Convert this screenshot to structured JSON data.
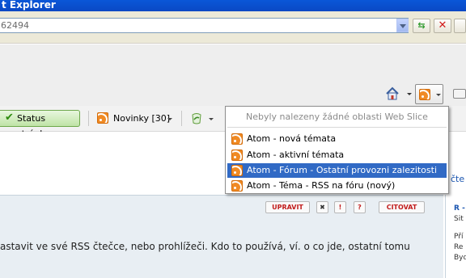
{
  "window": {
    "title": "t Explorer"
  },
  "address": {
    "value": "62494"
  },
  "toolbar": {
    "status_label": "Status stránky",
    "feeds_label": "Novinky [30]"
  },
  "feed_menu": {
    "note": "Nebyly nalezeny žádné oblasti Web Slice",
    "items": [
      {
        "label": "Atom - nová témata"
      },
      {
        "label": "Atom - aktivní témata"
      },
      {
        "label": "Atom - Fórum - Ostatní provozni zalezitosti",
        "highlighted": true
      },
      {
        "label": "Atom - Téma - RSS na fóru (nový)"
      }
    ]
  },
  "post": {
    "buttons": {
      "edit": "UPRAVIT",
      "delete": "✖",
      "report": "!",
      "help": "?",
      "quote": "CITOVAT"
    },
    "text": "astavit ve své RSS čtečce, nebo prohlížeči. Kdo to používá, ví. o co jde, ostatní tomu"
  },
  "sidebar": {
    "link": "čte",
    "author_prefix": "R -",
    "lines": [
      "Sit",
      "Pří",
      "Re",
      "Byd"
    ]
  },
  "colors": {
    "accent": "#316ac5",
    "feed": "#f08a24",
    "title_bar": "#0a57d8"
  }
}
